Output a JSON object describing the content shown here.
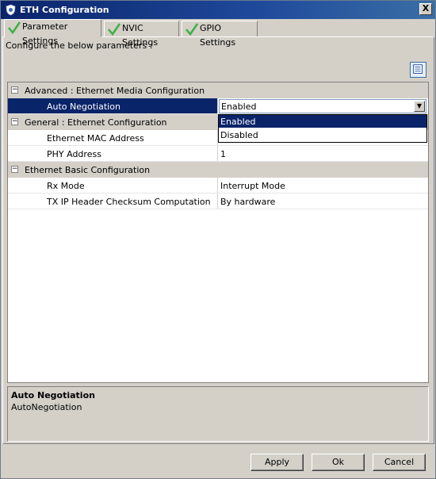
{
  "window": {
    "title": "ETH Configuration",
    "close_label": "X"
  },
  "tabs": [
    {
      "label": "Parameter Settings",
      "active": true
    },
    {
      "label": "NVIC Settings",
      "active": false
    },
    {
      "label": "GPIO Settings",
      "active": false
    }
  ],
  "configure_label": "Configure the below parameters :",
  "grid": {
    "groups": [
      {
        "label": "Advanced : Ethernet Media Configuration",
        "expander": "−"
      },
      {
        "label": "General : Ethernet Configuration",
        "expander": "−"
      },
      {
        "label": "Ethernet Basic Configuration",
        "expander": "−"
      }
    ],
    "properties": [
      {
        "name": "Auto Negotiation",
        "value": "Enabled"
      },
      {
        "name": "Ethernet MAC Address",
        "value": ""
      },
      {
        "name": "PHY Address",
        "value": "1"
      },
      {
        "name": "Rx Mode",
        "value": "Interrupt Mode"
      },
      {
        "name": "TX IP Header Checksum Computation",
        "value": "By hardware"
      }
    ],
    "combo_arrow": "▼"
  },
  "dropdown": {
    "options": [
      "Enabled",
      "Disabled"
    ],
    "selected": "Enabled"
  },
  "description": {
    "title": "Auto Negotiation",
    "text": "AutoNegotiation"
  },
  "buttons": {
    "apply": "Apply",
    "ok": "Ok",
    "cancel": "Cancel"
  },
  "colors": {
    "selection": "#0a246a",
    "titlebar": "#0a246a",
    "check": "#3cb043"
  }
}
